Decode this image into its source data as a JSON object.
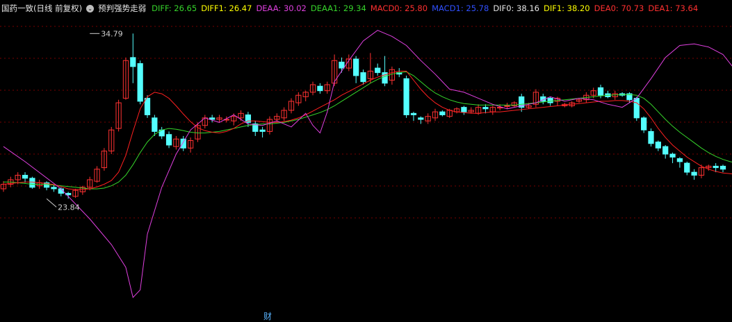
{
  "header": {
    "title": "国药一致(日线 前复权)",
    "indicator": "预判强势走弱",
    "values": [
      {
        "label": "DIFF: 26.65",
        "color": "#36d52b"
      },
      {
        "label": "DIFF1: 26.47",
        "color": "#ffff00"
      },
      {
        "label": "DEAA: 30.02",
        "color": "#e040e0"
      },
      {
        "label": "DEAA1: 29.34",
        "color": "#36d52b"
      },
      {
        "label": "MACD0: 25.80",
        "color": "#ff3030"
      },
      {
        "label": "MACD1: 25.78",
        "color": "#3050ff"
      },
      {
        "label": "DIF0: 38.16",
        "color": "#e6e6e6"
      },
      {
        "label": "DIF1: 38.20",
        "color": "#ffff00"
      },
      {
        "label": "DEA0: 70.73",
        "color": "#ff3030"
      },
      {
        "label": "DEA1: 73.64",
        "color": "#ff3030"
      }
    ]
  },
  "footer": {
    "fin_label": "财"
  },
  "colors": {
    "up": "#ff3232",
    "down": "#54ffff",
    "ma_red": "#ff2020",
    "ma_green": "#36d52b",
    "magenta": "#e040e0",
    "grid": "#7a0000"
  },
  "chart_data": {
    "type": "candlestick",
    "ylim": [
      16.5,
      36.0
    ],
    "annotations": [
      {
        "text": "34.79",
        "index": 12,
        "value": 34.79
      },
      {
        "text": "23.84",
        "index": 6,
        "value": 23.84
      }
    ],
    "candles": [
      [
        24.5,
        24.8,
        24.3,
        25.0
      ],
      [
        24.8,
        25.1,
        24.6,
        25.3
      ],
      [
        25.1,
        25.4,
        24.8,
        25.6
      ],
      [
        25.4,
        25.2,
        24.9,
        25.6
      ],
      [
        25.2,
        24.6,
        24.5,
        25.3
      ],
      [
        24.7,
        24.9,
        24.5,
        25.1
      ],
      [
        24.9,
        24.6,
        24.4,
        25.0
      ],
      [
        24.6,
        24.5,
        24.3,
        24.8
      ],
      [
        24.5,
        24.2,
        24.0,
        24.6
      ],
      [
        24.2,
        24.1,
        23.84,
        24.3
      ],
      [
        24.0,
        24.4,
        23.9,
        24.5
      ],
      [
        24.3,
        24.6,
        24.1,
        24.7
      ],
      [
        24.6,
        25.1,
        24.4,
        25.3
      ],
      [
        25.0,
        25.8,
        24.9,
        26.0
      ],
      [
        25.9,
        27.0,
        25.7,
        27.2
      ],
      [
        27.0,
        28.4,
        26.8,
        28.6
      ],
      [
        28.5,
        30.2,
        28.3,
        30.4
      ],
      [
        30.5,
        33.0,
        30.4,
        33.2
      ],
      [
        33.2,
        32.6,
        31.5,
        34.79
      ],
      [
        32.8,
        30.3,
        30.1,
        33.0
      ],
      [
        30.5,
        29.4,
        29.2,
        30.7
      ],
      [
        29.2,
        28.3,
        28.0,
        29.4
      ],
      [
        28.4,
        28.0,
        27.8,
        28.6
      ],
      [
        28.1,
        27.4,
        27.2,
        28.3
      ],
      [
        27.3,
        27.8,
        27.1,
        28.0
      ],
      [
        27.8,
        27.2,
        27.0,
        28.0
      ],
      [
        27.2,
        27.7,
        26.9,
        27.9
      ],
      [
        27.8,
        28.7,
        27.6,
        28.9
      ],
      [
        28.7,
        29.2,
        28.5,
        29.4
      ],
      [
        29.2,
        29.1,
        28.9,
        29.4
      ],
      [
        29.1,
        29.2,
        28.9,
        29.4
      ],
      [
        29.1,
        29.1,
        28.9,
        29.3
      ],
      [
        29.0,
        29.3,
        28.7,
        29.5
      ],
      [
        29.2,
        29.5,
        29.0,
        29.7
      ],
      [
        29.4,
        28.9,
        28.6,
        29.6
      ],
      [
        28.8,
        28.3,
        28.0,
        29.0
      ],
      [
        28.4,
        28.3,
        27.9,
        28.6
      ],
      [
        28.3,
        29.1,
        28.1,
        29.3
      ],
      [
        29.1,
        29.3,
        28.9,
        29.5
      ],
      [
        29.2,
        29.7,
        29.0,
        29.9
      ],
      [
        29.7,
        30.3,
        29.5,
        30.5
      ],
      [
        30.2,
        30.7,
        30.0,
        30.9
      ],
      [
        30.6,
        30.9,
        30.3,
        31.0
      ],
      [
        30.9,
        31.4,
        30.7,
        31.6
      ],
      [
        31.3,
        31.0,
        30.8,
        31.5
      ],
      [
        31.0,
        31.4,
        30.8,
        31.6
      ],
      [
        31.5,
        33.0,
        31.3,
        33.4
      ],
      [
        32.9,
        32.5,
        32.2,
        33.2
      ],
      [
        32.5,
        33.1,
        32.3,
        33.4
      ],
      [
        33.1,
        32.0,
        31.5,
        33.3
      ],
      [
        32.2,
        31.6,
        31.4,
        32.4
      ],
      [
        31.8,
        32.3,
        31.5,
        33.5
      ],
      [
        32.5,
        32.2,
        32.0,
        32.8
      ],
      [
        32.2,
        31.5,
        31.3,
        33.3
      ],
      [
        31.7,
        32.4,
        31.4,
        32.6
      ],
      [
        32.2,
        32.1,
        31.9,
        32.5
      ],
      [
        31.8,
        29.4,
        29.2,
        32.0
      ],
      [
        29.5,
        29.4,
        29.0,
        29.6
      ],
      [
        29.2,
        29.1,
        28.8,
        29.3
      ],
      [
        29.0,
        29.3,
        28.8,
        29.5
      ],
      [
        29.2,
        29.6,
        29.0,
        29.8
      ],
      [
        29.6,
        29.4,
        29.3,
        29.7
      ],
      [
        29.3,
        29.7,
        29.2,
        29.8
      ],
      [
        29.6,
        29.8,
        29.5,
        29.9
      ],
      [
        29.9,
        29.6,
        29.4,
        30.0
      ],
      [
        29.6,
        29.7,
        29.5,
        29.9
      ],
      [
        29.5,
        29.9,
        29.4,
        30.1
      ],
      [
        29.9,
        29.8,
        29.5,
        30.1
      ],
      [
        29.6,
        29.9,
        29.4,
        30.0
      ],
      [
        29.9,
        29.9,
        29.7,
        30.1
      ],
      [
        30.0,
        30.0,
        29.8,
        30.2
      ],
      [
        30.0,
        30.2,
        29.9,
        30.3
      ],
      [
        30.6,
        29.9,
        29.6,
        30.8
      ],
      [
        29.9,
        30.0,
        29.8,
        30.2
      ],
      [
        30.1,
        30.9,
        29.9,
        31.1
      ],
      [
        30.6,
        30.3,
        30.1,
        30.8
      ],
      [
        30.5,
        30.2,
        30.0,
        30.6
      ],
      [
        30.3,
        30.5,
        30.0,
        30.6
      ],
      [
        30.0,
        30.1,
        29.9,
        30.2
      ],
      [
        30.0,
        30.2,
        29.9,
        30.3
      ],
      [
        30.3,
        30.4,
        30.2,
        30.5
      ],
      [
        30.4,
        30.7,
        30.2,
        30.9
      ],
      [
        30.7,
        31.0,
        30.5,
        31.2
      ],
      [
        31.2,
        30.7,
        30.5,
        31.4
      ],
      [
        30.8,
        30.6,
        30.5,
        31.0
      ],
      [
        30.6,
        30.8,
        30.4,
        31.0
      ],
      [
        30.8,
        30.7,
        30.6,
        30.9
      ],
      [
        30.8,
        30.4,
        30.2,
        30.9
      ],
      [
        30.5,
        29.2,
        29.0,
        30.6
      ],
      [
        29.2,
        28.4,
        28.2,
        29.3
      ],
      [
        28.3,
        27.5,
        27.3,
        28.5
      ],
      [
        27.6,
        27.2,
        27.0,
        27.7
      ],
      [
        27.3,
        26.8,
        26.5,
        27.4
      ],
      [
        26.8,
        26.6,
        26.2,
        26.9
      ],
      [
        26.5,
        26.3,
        25.9,
        26.6
      ],
      [
        26.2,
        25.6,
        25.4,
        26.3
      ],
      [
        25.6,
        25.4,
        25.1,
        25.8
      ],
      [
        25.4,
        25.9,
        25.2,
        26.1
      ],
      [
        25.9,
        26.0,
        25.7,
        26.1
      ],
      [
        26.0,
        25.9,
        25.6,
        26.2
      ],
      [
        26.0,
        25.8,
        25.6,
        26.1
      ]
    ],
    "ma_red": [
      24.8,
      24.85,
      24.9,
      24.95,
      24.95,
      24.9,
      24.85,
      24.78,
      24.65,
      24.5,
      24.45,
      24.45,
      24.5,
      24.62,
      24.8,
      25.05,
      25.6,
      26.7,
      28.3,
      29.8,
      30.6,
      30.9,
      30.8,
      30.5,
      30.0,
      29.45,
      28.95,
      28.55,
      28.35,
      28.25,
      28.2,
      28.3,
      28.5,
      28.8,
      29.0,
      29.0,
      28.95,
      28.9,
      28.9,
      28.95,
      29.05,
      29.2,
      29.4,
      29.65,
      29.9,
      30.15,
      30.4,
      30.7,
      30.95,
      31.2,
      31.45,
      31.7,
      31.9,
      32.05,
      32.2,
      32.3,
      32.3,
      31.7,
      31.1,
      30.6,
      30.2,
      29.9,
      29.7,
      29.6,
      29.55,
      29.5,
      29.5,
      29.55,
      29.6,
      29.6,
      29.65,
      29.7,
      29.75,
      29.8,
      29.85,
      29.9,
      29.95,
      30.0,
      30.05,
      30.1,
      30.15,
      30.2,
      30.25,
      30.3,
      30.3,
      30.35,
      30.35,
      30.3,
      30.2,
      29.8,
      29.2,
      28.5,
      27.9,
      27.4,
      27.0,
      26.6,
      26.3,
      26.0,
      25.8,
      25.65,
      25.55,
      25.5,
      25.45
    ],
    "ma_green": [
      24.95,
      24.95,
      24.9,
      24.85,
      24.8,
      24.8,
      24.78,
      24.75,
      24.7,
      24.65,
      24.6,
      24.55,
      24.5,
      24.5,
      24.55,
      24.7,
      24.95,
      25.4,
      26.1,
      26.9,
      27.6,
      28.1,
      28.4,
      28.5,
      28.45,
      28.35,
      28.25,
      28.2,
      28.2,
      28.25,
      28.3,
      28.4,
      28.5,
      28.6,
      28.7,
      28.75,
      28.8,
      28.8,
      28.85,
      28.9,
      29.0,
      29.1,
      29.25,
      29.4,
      29.55,
      29.75,
      30.0,
      30.3,
      30.6,
      30.9,
      31.2,
      31.5,
      31.75,
      31.95,
      32.1,
      32.2,
      32.25,
      32.0,
      31.6,
      31.2,
      30.85,
      30.6,
      30.4,
      30.25,
      30.15,
      30.1,
      30.05,
      30.05,
      30.05,
      30.05,
      30.05,
      30.05,
      30.1,
      30.15,
      30.2,
      30.25,
      30.3,
      30.35,
      30.4,
      30.45,
      30.5,
      30.55,
      30.6,
      30.65,
      30.7,
      30.72,
      30.74,
      30.75,
      30.7,
      30.5,
      30.1,
      29.6,
      29.1,
      28.65,
      28.25,
      27.9,
      27.55,
      27.2,
      26.9,
      26.65,
      26.45,
      26.3,
      26.2
    ],
    "magenta": [
      [
        0,
        27.3
      ],
      [
        3,
        26.3
      ],
      [
        8,
        24.5
      ],
      [
        12,
        22.5
      ],
      [
        15,
        20.8
      ],
      [
        17,
        19.3
      ],
      [
        18,
        17.3
      ],
      [
        19,
        17.8
      ],
      [
        20,
        21.5
      ],
      [
        22,
        24.6
      ],
      [
        24,
        26.8
      ],
      [
        26,
        28.4
      ],
      [
        28,
        29.2
      ],
      [
        30,
        28.9
      ],
      [
        32,
        29.4
      ],
      [
        34,
        28.8
      ],
      [
        36,
        28.7
      ],
      [
        38,
        29.0
      ],
      [
        40,
        28.6
      ],
      [
        42,
        29.5
      ],
      [
        43,
        28.7
      ],
      [
        44,
        28.2
      ],
      [
        45,
        29.6
      ],
      [
        46,
        31.6
      ],
      [
        48,
        33.0
      ],
      [
        50,
        34.3
      ],
      [
        52,
        35.0
      ],
      [
        54,
        34.6
      ],
      [
        56,
        34.0
      ],
      [
        58,
        33.0
      ],
      [
        60,
        32.1
      ],
      [
        62,
        31.1
      ],
      [
        64,
        30.9
      ],
      [
        66,
        30.5
      ],
      [
        68,
        30.1
      ],
      [
        70,
        29.8
      ],
      [
        72,
        30.0
      ],
      [
        74,
        30.2
      ],
      [
        76,
        30.6
      ],
      [
        78,
        30.3
      ],
      [
        80,
        30.5
      ],
      [
        82,
        30.4
      ],
      [
        84,
        30.1
      ],
      [
        86,
        29.9
      ],
      [
        88,
        30.5
      ],
      [
        90,
        31.8
      ],
      [
        92,
        33.2
      ],
      [
        94,
        34.0
      ],
      [
        96,
        34.1
      ],
      [
        98,
        33.9
      ],
      [
        100,
        33.4
      ],
      [
        102,
        32.2
      ],
      [
        104,
        30.8
      ]
    ]
  }
}
